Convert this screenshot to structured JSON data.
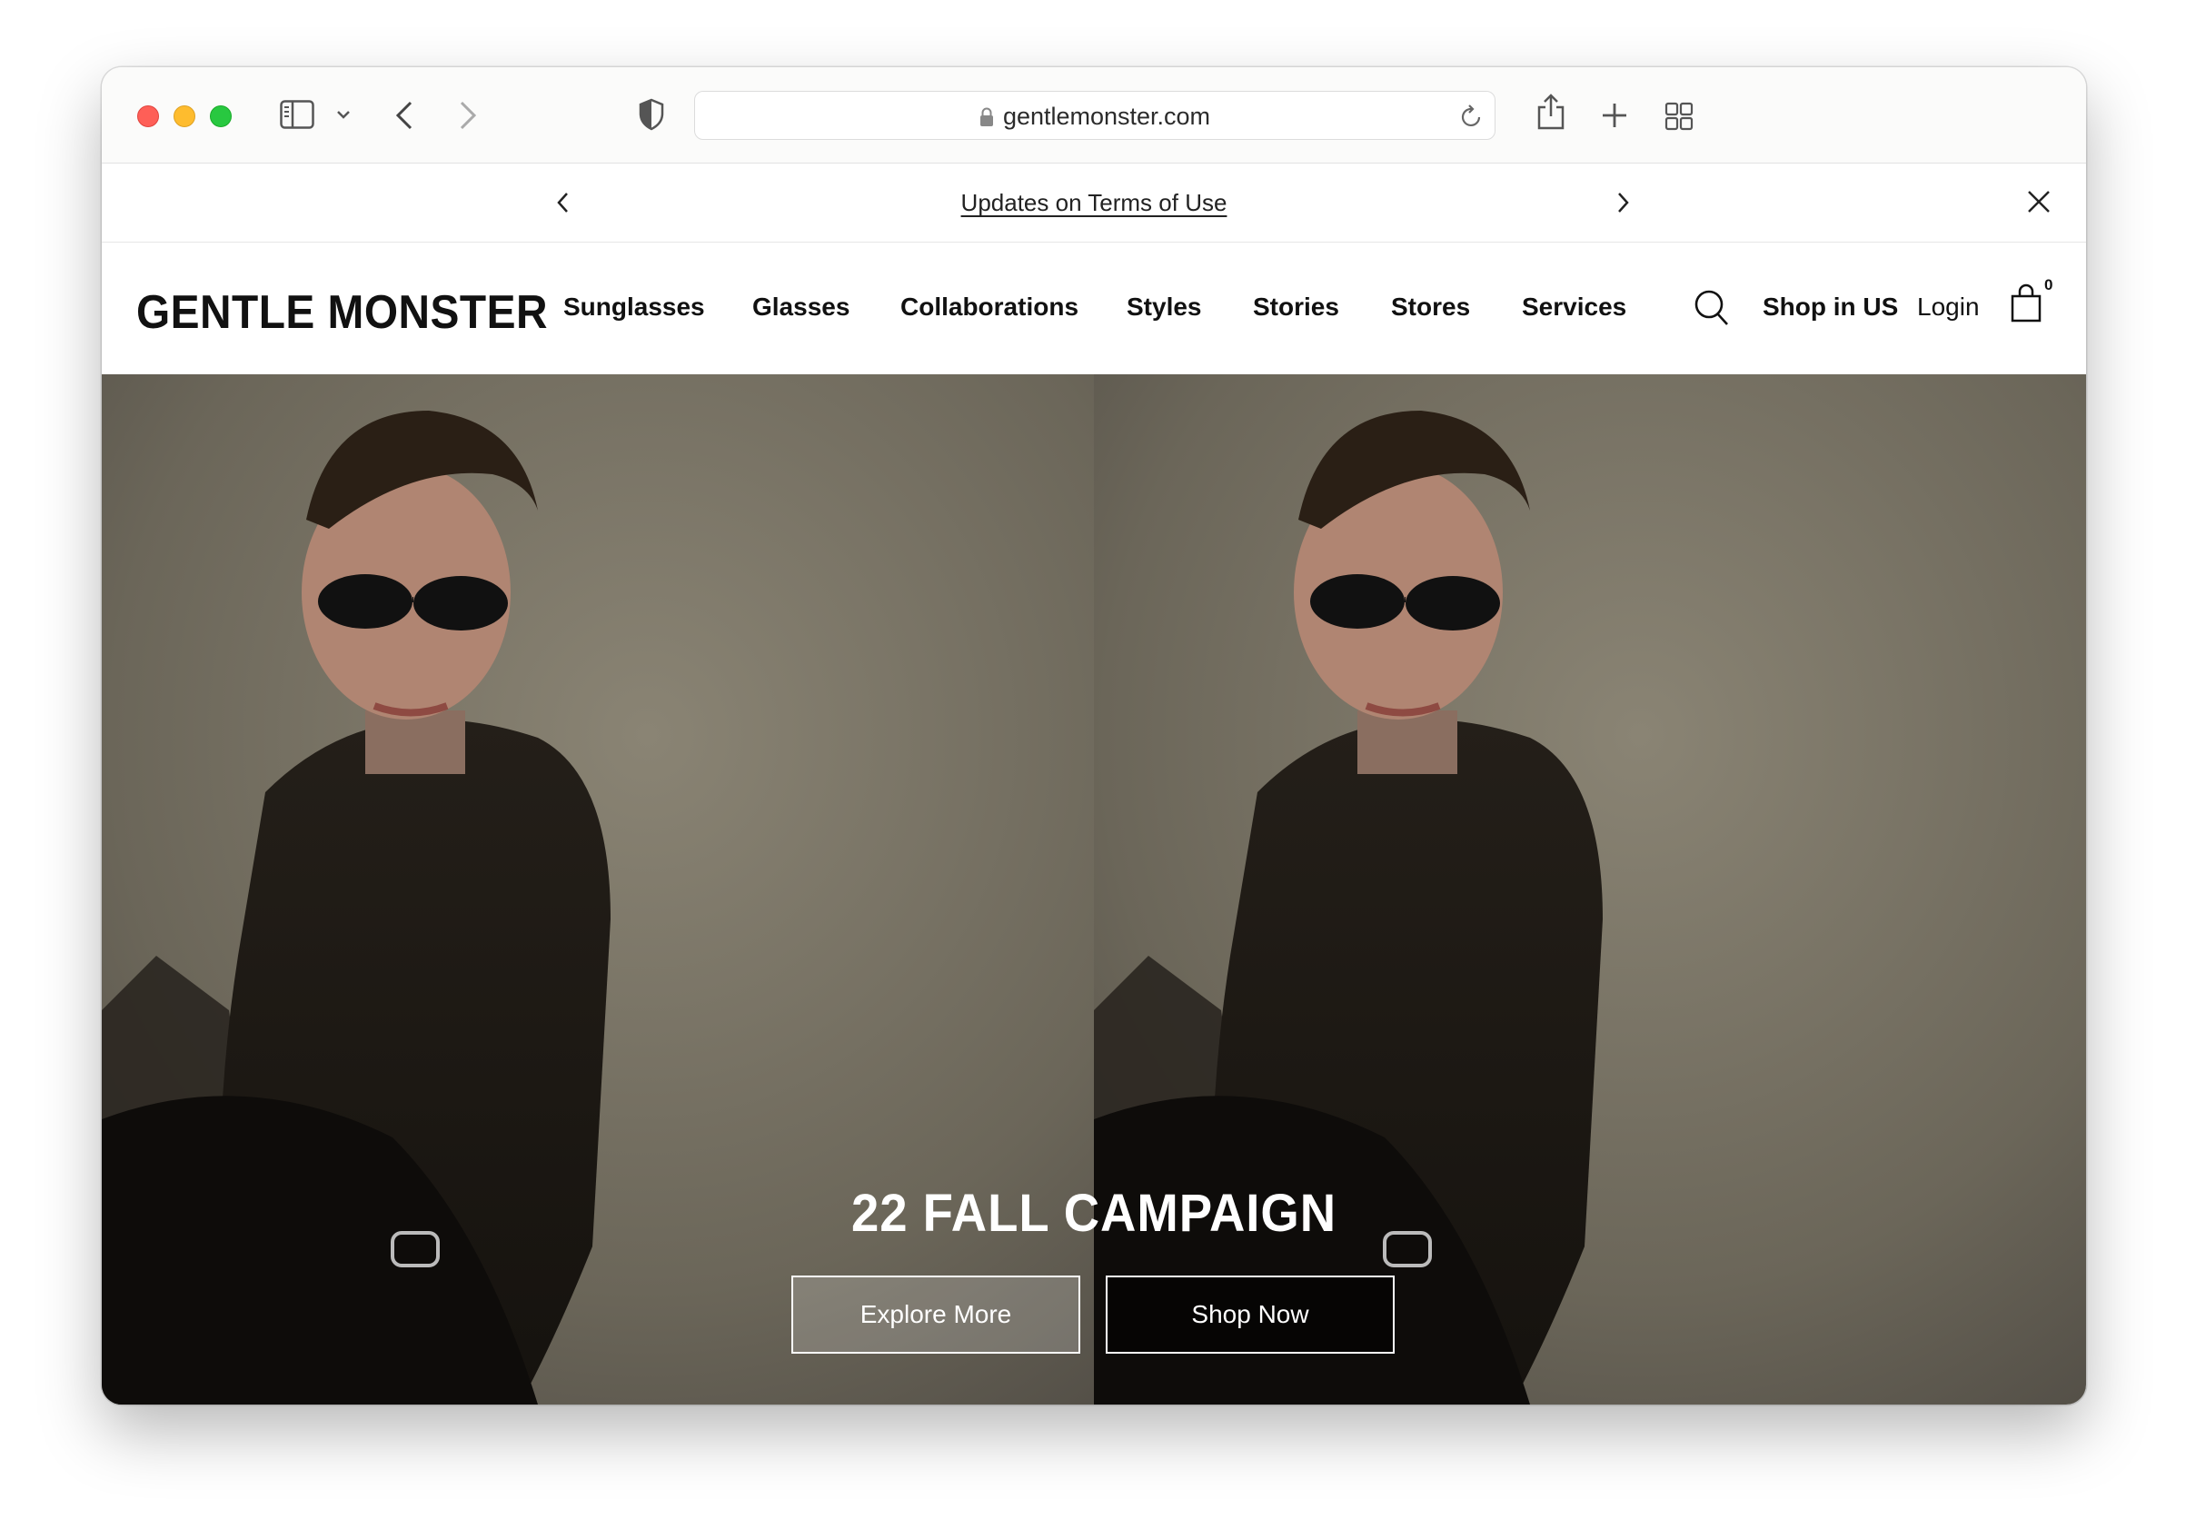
{
  "browser": {
    "url": "gentlemonster.com",
    "icons": [
      "sidebar-icon",
      "chevron-down-icon",
      "back-icon",
      "forward-icon",
      "shield-icon",
      "lock-icon",
      "reload-icon",
      "share-icon",
      "plus-icon",
      "tabs-grid-icon"
    ]
  },
  "announcement": {
    "text": "Updates on Terms of Use"
  },
  "site": {
    "logo": "GENTLE MONSTER",
    "nav": [
      "Sunglasses",
      "Glasses",
      "Collaborations",
      "Styles",
      "Stories",
      "Stores",
      "Services"
    ],
    "shop_region": "Shop in US",
    "login": "Login",
    "cart_count": "0"
  },
  "hero": {
    "title": "22 FALL CAMPAIGN",
    "explore_label": "Explore More",
    "shop_label": "Shop Now"
  },
  "colors": {
    "text": "#111111",
    "hero_bg": "#6b6659",
    "garment": "#1e1a15"
  }
}
